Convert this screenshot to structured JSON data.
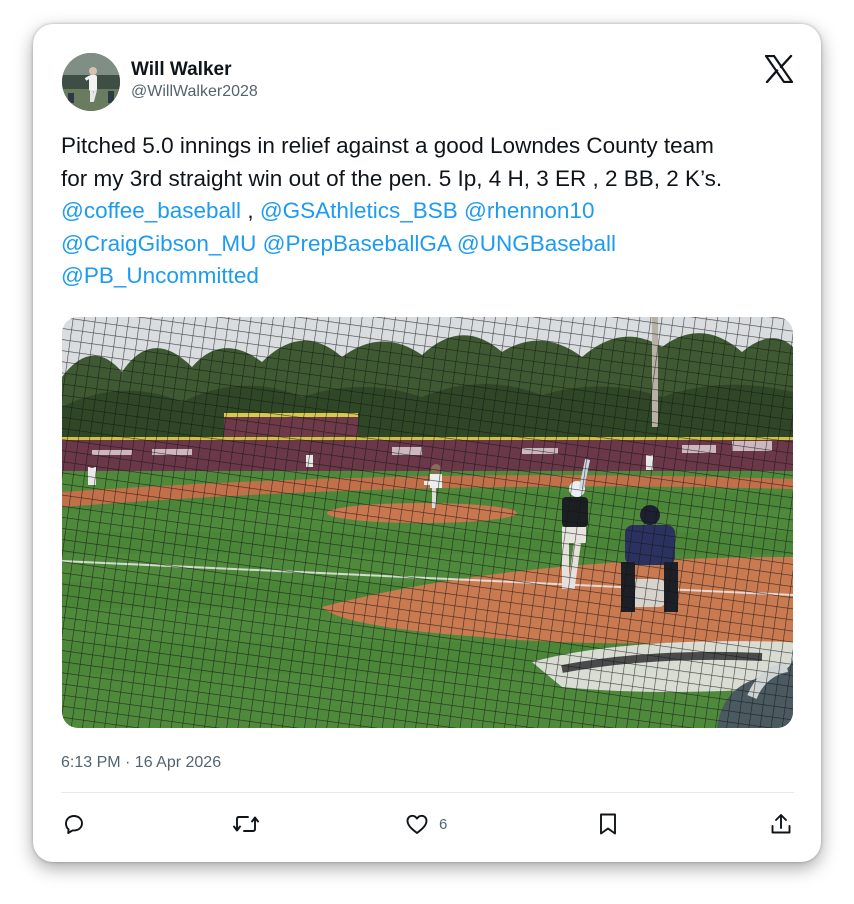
{
  "tweet": {
    "author_name": "Will Walker",
    "author_handle": "@WillWalker2028",
    "text_line1": "Pitched 5.0 innings in relief against a good Lowndes County team",
    "text_line2": "for my 3rd straight win out of the pen. 5 Ip, 4 H, 3 ER , 2 BB, 2 K’s.",
    "mention1": "@coffee_baseball",
    "separator": " , ",
    "mention2": "@GSAthletics_BSB",
    "mention3": "@rhennon10",
    "mention4": "@CraigGibson_MU",
    "mention5": "@PrepBaseballGA",
    "mention6": "@UNGBaseball",
    "mention7": "@PB_Uncommitted",
    "timestamp": "6:13 PM · 16 Apr 2026"
  },
  "actions": {
    "reply_icon": "reply-icon",
    "retweet_icon": "retweet-icon",
    "like_icon": "heart-icon",
    "like_count": "6",
    "bookmark_icon": "bookmark-icon",
    "share_icon": "share-icon"
  },
  "colors": {
    "link": "#1d9bf0",
    "secondary_text": "#536471",
    "primary_text": "#0f1419"
  }
}
